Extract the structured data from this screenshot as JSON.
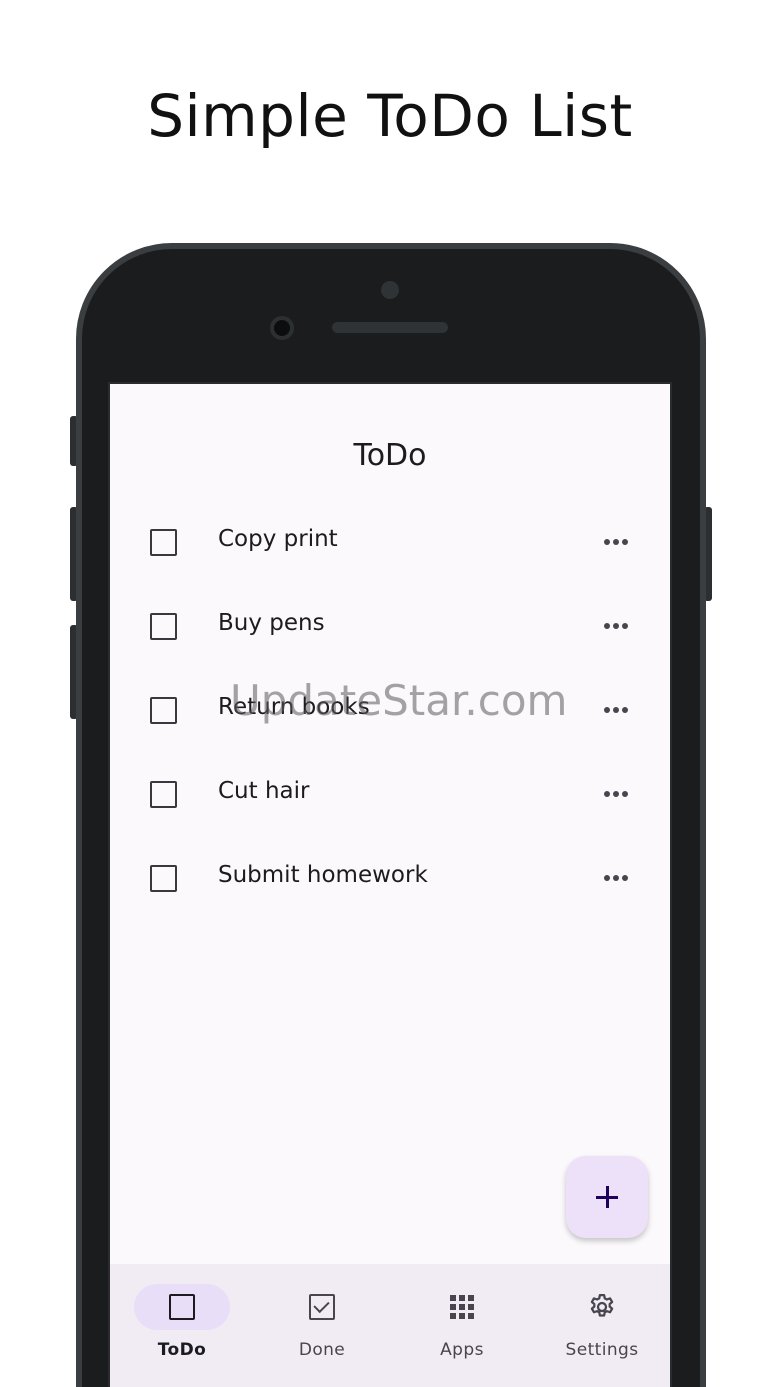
{
  "promo": {
    "title": "Simple ToDo List"
  },
  "watermark": "UpdateStar.com",
  "app": {
    "title": "ToDo",
    "todos": [
      {
        "label": "Copy print",
        "checked": false,
        "menu_icon": "more-horiz-icon"
      },
      {
        "label": "Buy pens",
        "checked": false,
        "menu_icon": "more-horiz-icon"
      },
      {
        "label": "Return books",
        "checked": false,
        "menu_icon": "more-horiz-icon"
      },
      {
        "label": "Cut hair",
        "checked": false,
        "menu_icon": "more-horiz-icon"
      },
      {
        "label": "Submit homework",
        "checked": false,
        "menu_icon": "more-horiz-icon"
      }
    ],
    "fab": {
      "icon": "plus-icon"
    },
    "nav": [
      {
        "label": "ToDo",
        "icon": "checkbox-blank-icon",
        "active": true
      },
      {
        "label": "Done",
        "icon": "checkbox-checked-icon",
        "active": false
      },
      {
        "label": "Apps",
        "icon": "apps-grid-icon",
        "active": false
      },
      {
        "label": "Settings",
        "icon": "gear-icon",
        "active": false
      }
    ]
  },
  "colors": {
    "screen_bg": "#fcf9fc",
    "nav_bg": "#f1ecf4",
    "active_pill": "#e8def8",
    "fab_bg": "#ece1f8",
    "fab_icon": "#21005d",
    "phone_frame": "#1a1c1d"
  }
}
